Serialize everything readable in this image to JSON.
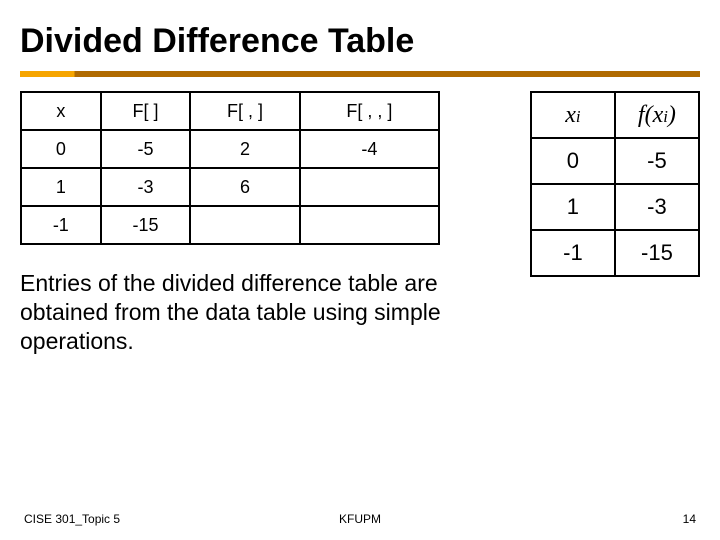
{
  "title": "Divided Difference Table",
  "dd_table": {
    "headers": [
      "x",
      "F[  ]",
      "F[  ,  ]",
      "F[  ,  ,  ]"
    ],
    "rows": [
      [
        "0",
        "-5",
        "2",
        "-4"
      ],
      [
        "1",
        "-3",
        "6",
        ""
      ],
      [
        "-1",
        "-15",
        "",
        ""
      ]
    ]
  },
  "data_table": {
    "headers": [
      "x_i",
      "f(x_i)"
    ],
    "rows": [
      [
        "0",
        "-5"
      ],
      [
        "1",
        "-3"
      ],
      [
        "-1",
        "-15"
      ]
    ]
  },
  "description": "Entries of the divided difference table are obtained from the data table using simple operations.",
  "footer": {
    "left": "CISE 301_Topic 5",
    "center": "KFUPM",
    "right": "14"
  },
  "chart_data": {
    "type": "table",
    "title": "Divided Difference Table",
    "tables": [
      {
        "name": "divided_difference",
        "columns": [
          "x",
          "F[ ]",
          "F[ , ]",
          "F[ , , ]"
        ],
        "rows": [
          [
            0,
            -5,
            2,
            -4
          ],
          [
            1,
            -3,
            6,
            null
          ],
          [
            -1,
            -15,
            null,
            null
          ]
        ]
      },
      {
        "name": "data_points",
        "columns": [
          "x_i",
          "f(x_i)"
        ],
        "rows": [
          [
            0,
            -5
          ],
          [
            1,
            -3
          ],
          [
            -1,
            -15
          ]
        ]
      }
    ]
  }
}
